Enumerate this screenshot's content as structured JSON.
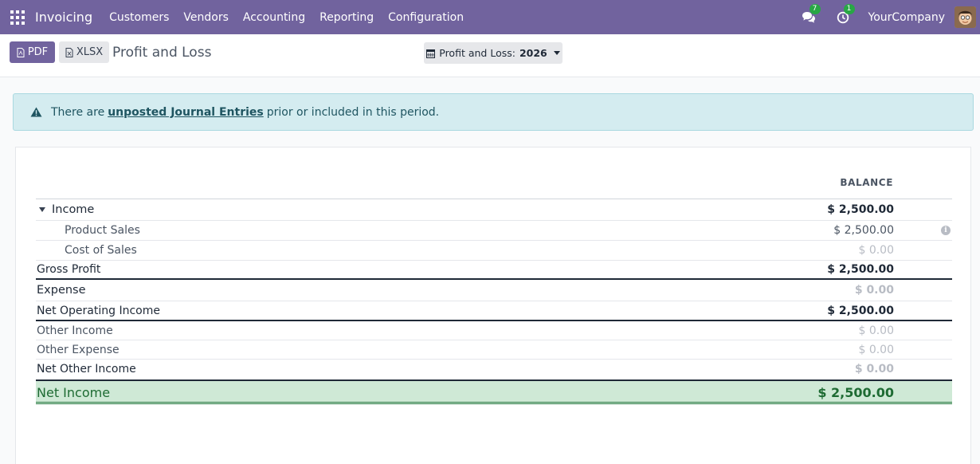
{
  "navbar": {
    "brand": "Invoicing",
    "menu": [
      "Customers",
      "Vendors",
      "Accounting",
      "Reporting",
      "Configuration"
    ],
    "messages_count": "7",
    "activities_count": "1",
    "company": "YourCompany"
  },
  "control_panel": {
    "pdf_label": "PDF",
    "xlsx_label": "XLSX",
    "title": "Profit and Loss",
    "filter_prefix": "Profit and Loss:",
    "filter_year": "2026"
  },
  "alert": {
    "before": "There are",
    "link": "unposted Journal Entries",
    "after": "prior or included in this period."
  },
  "report": {
    "column_header": "BALANCE",
    "rows": [
      {
        "label": "Income",
        "value": "$ 2,500.00"
      },
      {
        "label": "Product Sales",
        "value": "$ 2,500.00"
      },
      {
        "label": "Cost of Sales",
        "value": "$ 0.00"
      },
      {
        "label": "Gross Profit",
        "value": "$ 2,500.00"
      },
      {
        "label": "Expense",
        "value": "$ 0.00"
      },
      {
        "label": "Net Operating Income",
        "value": "$ 2,500.00"
      },
      {
        "label": "Other Income",
        "value": "$ 0.00"
      },
      {
        "label": "Other Expense",
        "value": "$ 0.00"
      },
      {
        "label": "Net Other Income",
        "value": "$ 0.00"
      }
    ],
    "net_income": {
      "label": "Net Income",
      "value": "$ 2,500.00"
    }
  }
}
